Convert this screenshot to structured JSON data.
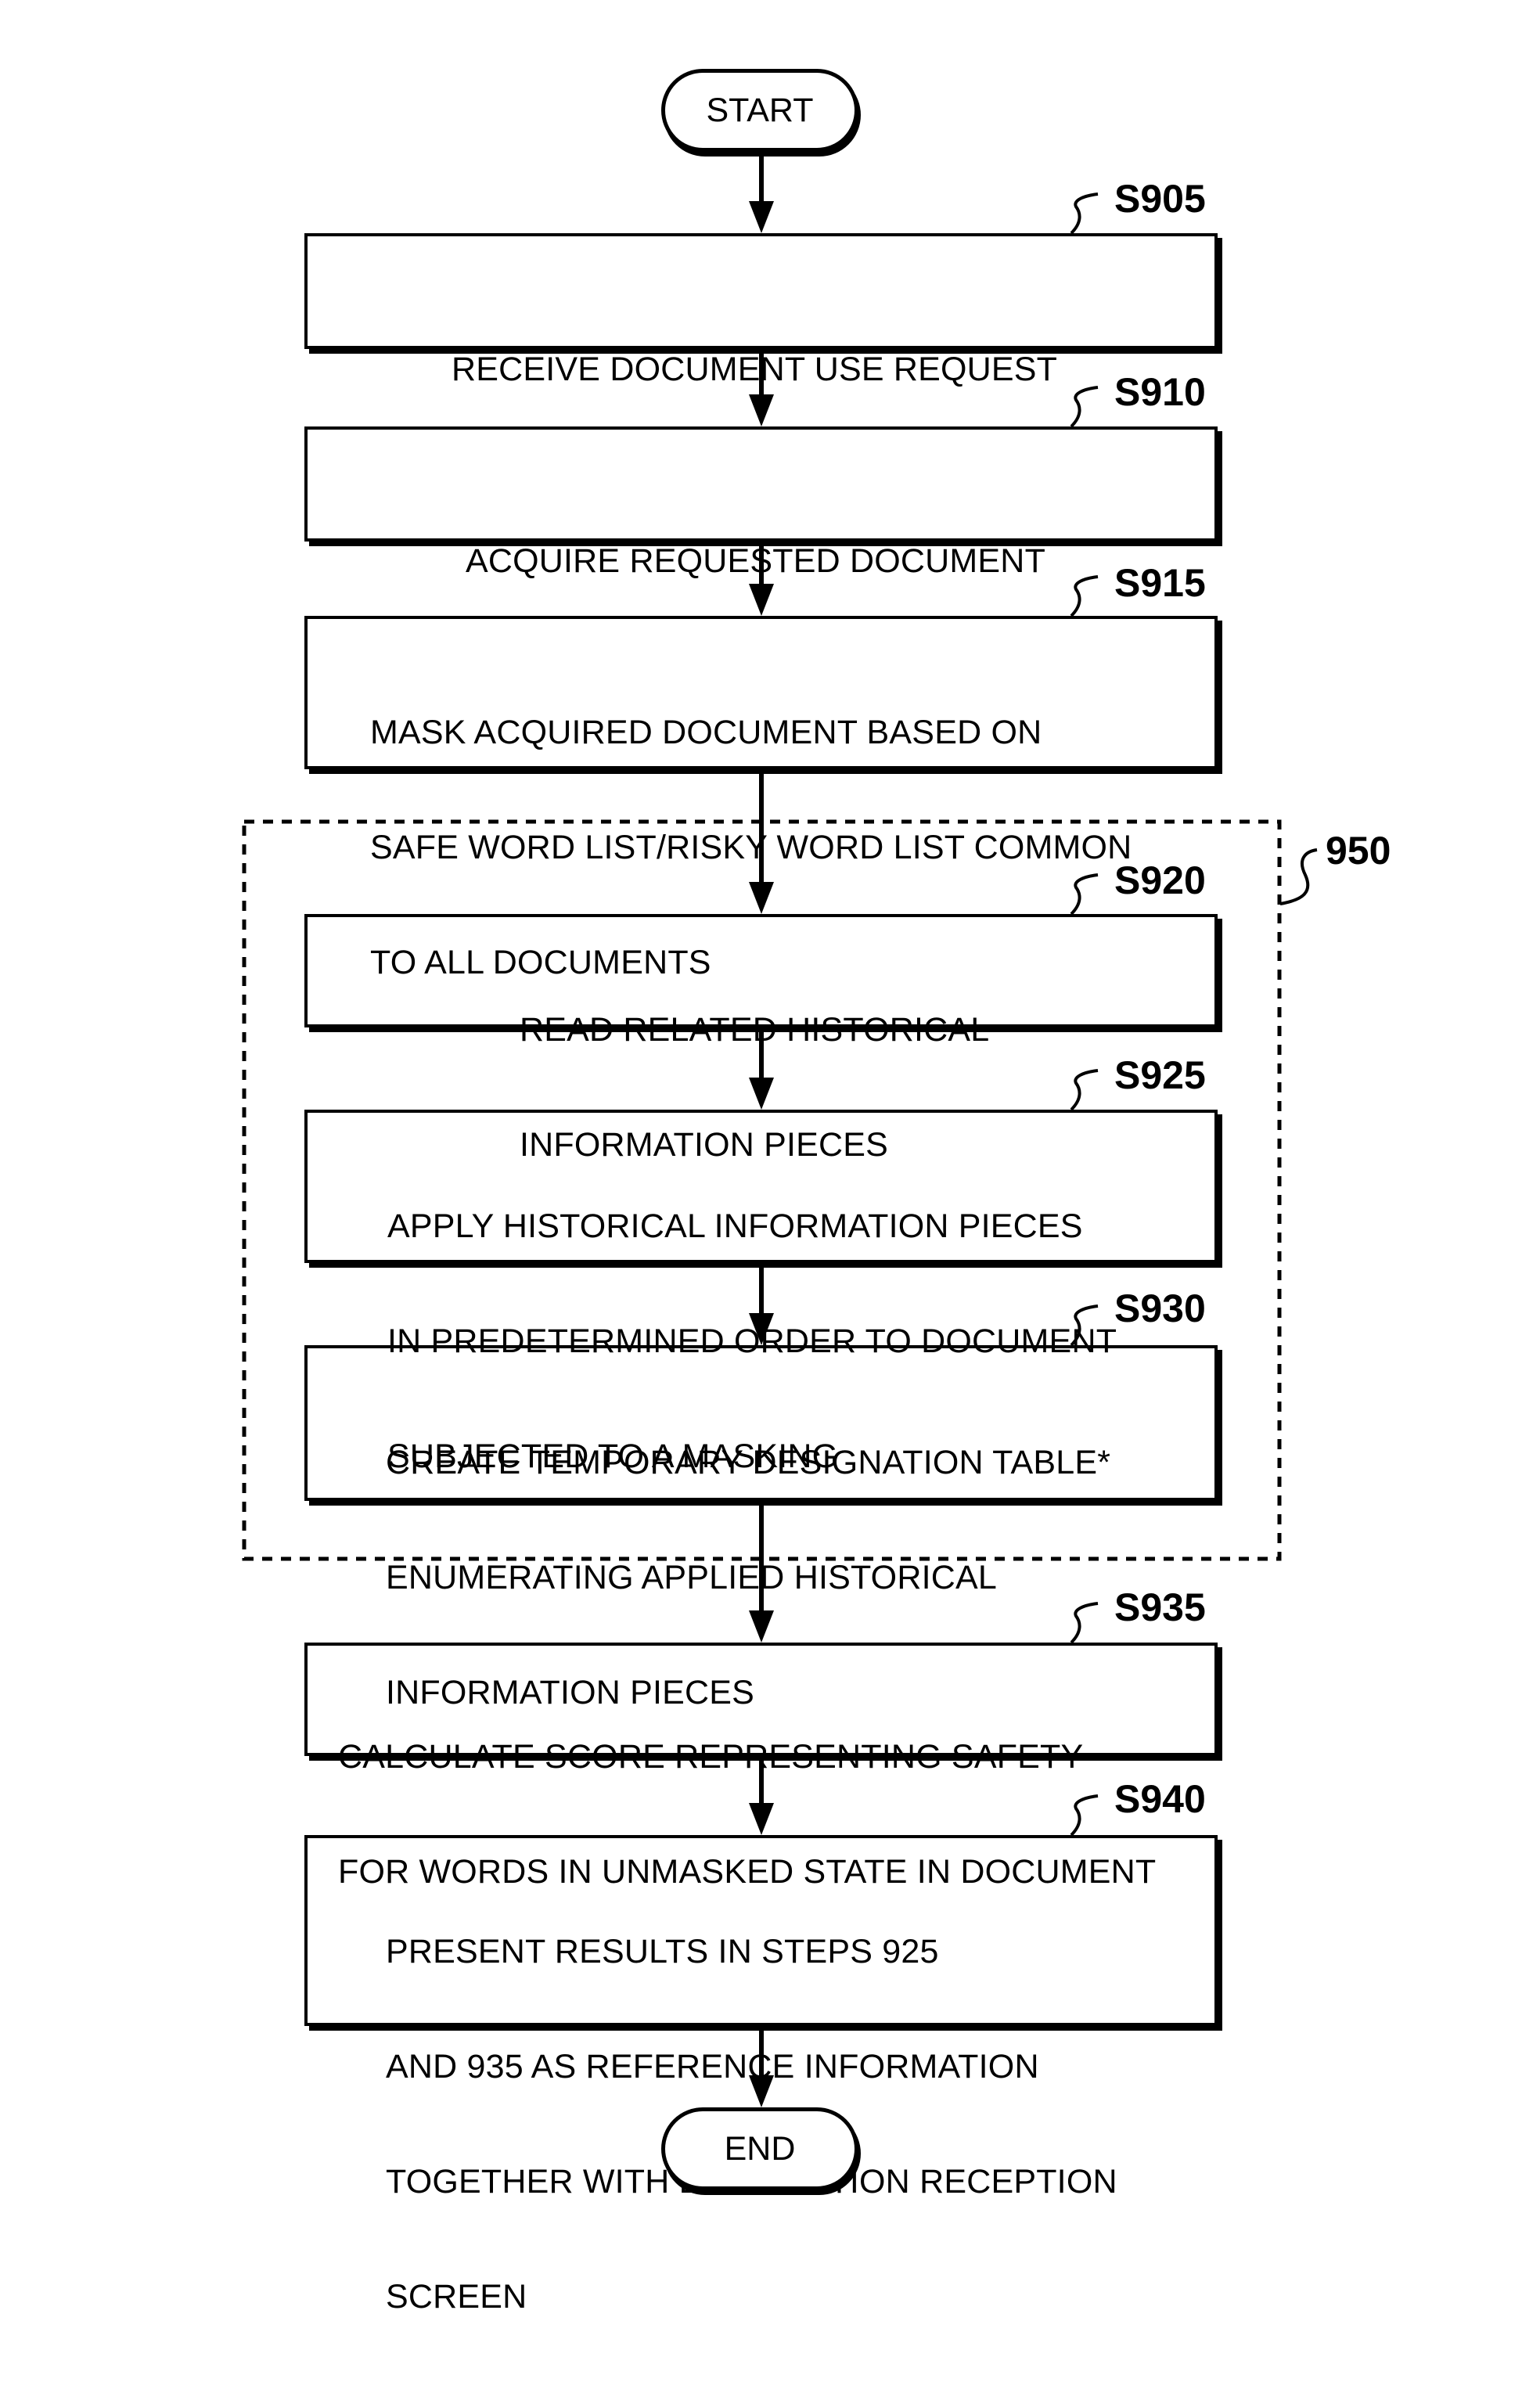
{
  "figure": {
    "start_label": "START",
    "end_label": "END",
    "group": {
      "label": "950",
      "description": "dashed region grouping steps S920-S930"
    },
    "steps": [
      {
        "id": "S905",
        "lines": [
          "RECEIVE DOCUMENT USE REQUEST"
        ]
      },
      {
        "id": "S910",
        "lines": [
          "ACQUIRE REQUESTED DOCUMENT"
        ]
      },
      {
        "id": "S915",
        "lines": [
          "MASK ACQUIRED DOCUMENT BASED ON",
          "SAFE WORD LIST/RISKY WORD LIST COMMON",
          "TO ALL DOCUMENTS"
        ]
      },
      {
        "id": "S920",
        "lines": [
          "READ RELATED HISTORICAL",
          "INFORMATION PIECES"
        ]
      },
      {
        "id": "S925",
        "lines": [
          "APPLY HISTORICAL INFORMATION PIECES",
          "IN PREDETERMINED ORDER TO DOCUMENT",
          "SUBJECTED TO A MASKING"
        ]
      },
      {
        "id": "S930",
        "lines": [
          "CREATE TEMPORARY DESIGNATION TABLE*",
          "ENUMERATING APPLIED HISTORICAL",
          "INFORMATION PIECES"
        ]
      },
      {
        "id": "S935",
        "lines": [
          "CALCULATE SCORE REPRESENTING SAFETY",
          "FOR WORDS IN UNMASKED STATE IN DOCUMENT"
        ]
      },
      {
        "id": "S940",
        "lines": [
          "PRESENT RESULTS IN STEPS 925",
          "AND 935 AS REFERENCE INFORMATION",
          "TOGETHER WITH DESIGNATION RECEPTION",
          "SCREEN"
        ]
      }
    ],
    "flow": [
      "START",
      "S905",
      "S910",
      "S915",
      "S920",
      "S925",
      "S930",
      "S935",
      "S940",
      "END"
    ],
    "colors": {
      "ink": "#000000",
      "paper": "#ffffff"
    }
  }
}
